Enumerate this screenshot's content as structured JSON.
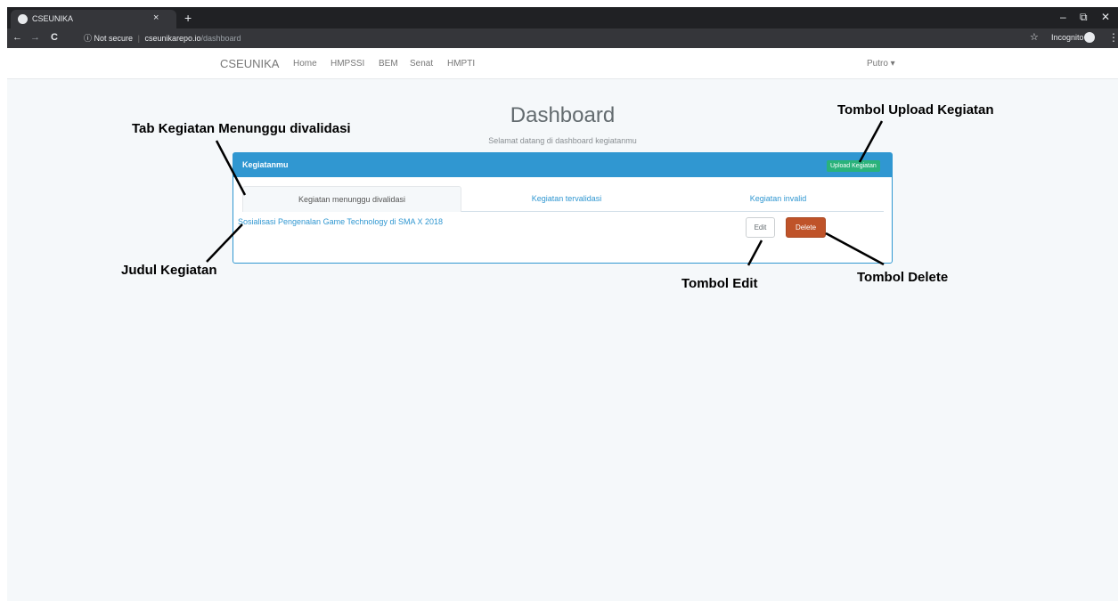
{
  "browser": {
    "tab_title": "CSEUNIKA",
    "tab_close": "×",
    "new_tab": "+",
    "nav_back": "←",
    "nav_forward": "→",
    "reload": "C",
    "security_icon": "ⓘ",
    "security_label": "Not secure",
    "url_host": "cseunikarepo.io",
    "url_path": "/dashboard",
    "star": "☆",
    "incognito_label": "Incognito",
    "menu": "⋮",
    "win_min": "–",
    "win_restore": "⧉",
    "win_close": "✕"
  },
  "navbar": {
    "brand": "CSEUNIKA",
    "links": [
      "Home",
      "HMPSSI",
      "BEM",
      "Senat",
      "HMPTI"
    ],
    "user": "Putro ▾"
  },
  "dashboard": {
    "title": "Dashboard",
    "subtitle": "Selamat datang di dashboard kegiatanmu"
  },
  "panel": {
    "title": "Kegiatanmu",
    "upload_label": "Upload Kegiatan",
    "tabs": [
      {
        "label": "Kegiatan menunggu divalidasi",
        "active": true
      },
      {
        "label": "Kegiatan tervalidasi",
        "active": false
      },
      {
        "label": "Kegiatan invalid",
        "active": false
      }
    ],
    "items": [
      {
        "title": "Sosialisasi Pengenalan Game Technology di SMA X 2018",
        "edit_label": "Edit",
        "delete_label": "Delete"
      }
    ]
  },
  "annotations": {
    "tab": "Tab Kegiatan Menunggu divalidasi",
    "upload": "Tombol Upload Kegiatan",
    "judul": "Judul Kegiatan",
    "edit": "Tombol Edit",
    "delete": "Tombol Delete"
  },
  "colors": {
    "primary": "#3097d1",
    "success": "#2ab27b",
    "danger": "#bf5329",
    "page_bg": "#f5f8fa"
  }
}
